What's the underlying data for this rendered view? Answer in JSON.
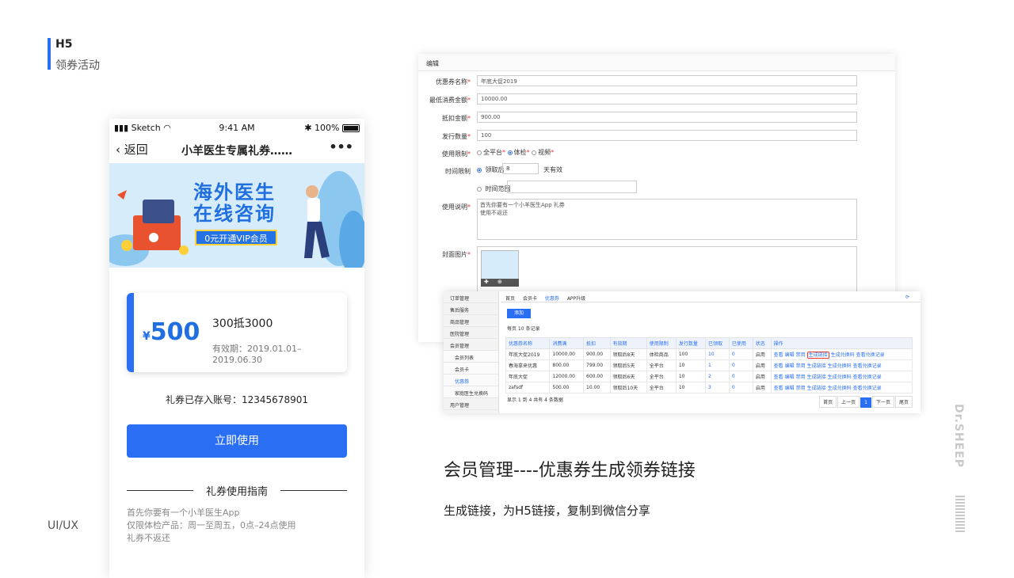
{
  "section": {
    "title": "H5",
    "subtitle": "领券活动"
  },
  "footer_label": "UI/UX",
  "phone": {
    "carrier": "Sketch",
    "time": "9:41 AM",
    "battery": "100%",
    "back_label": "返回",
    "title": "小羊医生专属礼券……",
    "more_icon": "more-dots-icon",
    "banner": {
      "line1": "海外医生",
      "line2": "在线咨询",
      "vip": "0元开通VIP会员"
    },
    "coupon": {
      "currency": "¥",
      "amount": "500",
      "name": "300抵3000",
      "validity": "有效期：2019.01.01–2019.06.30"
    },
    "account_text": "礼券已存入账号：12345678901",
    "use_button": "立即使用",
    "guide_title": "礼券使用指南",
    "rules": [
      "首先你要有一个小羊医生App",
      "仅限体检产品：周一至周五，0点–24点使用",
      "礼券不返还"
    ]
  },
  "edit_form": {
    "header": "编辑",
    "fields": [
      {
        "label": "优惠券名称",
        "value": "年底大促2019"
      },
      {
        "label": "最低消费金额",
        "value": "10000.00"
      },
      {
        "label": "抵扣金额",
        "value": "900.00"
      },
      {
        "label": "发行数量",
        "value": "100"
      }
    ],
    "usage_label": "使用限制",
    "usage_options": [
      "全平台",
      "体检",
      "视频"
    ],
    "time_label": "时间限制",
    "time_opt1": "领取后",
    "time_days": "8",
    "time_unit": "天有效",
    "time_opt2": "时间范围",
    "desc_label": "使用说明",
    "desc_value": "首先你要有一个小羊医生App 礼券使用不返还",
    "cover_label": "封面图片"
  },
  "list_panel": {
    "sidebar": [
      {
        "label": "订单管理",
        "sub": false,
        "active": false
      },
      {
        "label": "售后服务",
        "sub": false,
        "active": false
      },
      {
        "label": "商品管理",
        "sub": false,
        "active": false
      },
      {
        "label": "医院管理",
        "sub": false,
        "active": false
      },
      {
        "label": "会员管理",
        "sub": false,
        "active": true
      },
      {
        "label": "会员列表",
        "sub": true,
        "active": false
      },
      {
        "label": "会员卡",
        "sub": true,
        "active": false
      },
      {
        "label": "优惠券",
        "sub": true,
        "active": true
      },
      {
        "label": "家庭医生兑换码",
        "sub": true,
        "active": false
      },
      {
        "label": "用户管理",
        "sub": false,
        "active": false
      }
    ],
    "tabs": [
      "首页",
      "会员卡",
      "优惠券",
      "APP升级"
    ],
    "add_button": "添加",
    "per_page": "每页 10 条记录",
    "columns": [
      "优惠券名称",
      "消费满",
      "抵扣",
      "有效期",
      "使用限制",
      "发行数量",
      "已领取",
      "已使用",
      "状态",
      "操作"
    ],
    "rows": [
      [
        "年底大促2019",
        "10000.00",
        "900.00",
        "领取后8天",
        "体检商品",
        "100",
        "10",
        "0",
        "启用"
      ],
      [
        "春海拿来优惠",
        "800.00",
        "799.00",
        "领取后5天",
        "全平台",
        "10",
        "1",
        "0",
        "启用"
      ],
      [
        "年底大促",
        "12000.00",
        "600.00",
        "领取后6天",
        "全平台",
        "10",
        "2",
        "0",
        "启用"
      ],
      [
        "zafsdf",
        "500.00",
        "10.00",
        "领取后10天",
        "全平台",
        "10",
        "3",
        "0",
        "启用"
      ]
    ],
    "actions": [
      "查看",
      "编辑",
      "禁用",
      "生成链接",
      "生成兑换码",
      "查看兑换记录"
    ],
    "footer": "显示 1 到 4 共有 4 条数据",
    "pager": [
      "首页",
      "上一页",
      "1",
      "下一页",
      "尾页"
    ]
  },
  "caption": {
    "highlight": "会员管理",
    "rest": "----优惠券生成领券链接"
  },
  "description": "生成链接，为H5链接，复制到微信分享",
  "brand": "Dr.SHEEP",
  "colors": {
    "primary": "#2a6ff3",
    "highlight_border": "#e33333"
  }
}
